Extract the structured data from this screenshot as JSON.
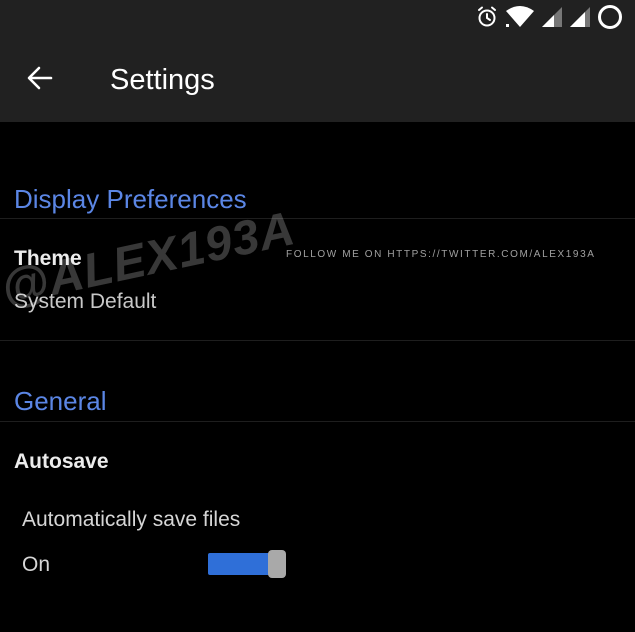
{
  "status_bar": {
    "icons": [
      "alarm-icon",
      "wifi-icon",
      "signal-icon",
      "signal-icon-2",
      "battery-ring-icon"
    ]
  },
  "app_bar": {
    "title": "Settings",
    "back_icon": "arrow-left-icon"
  },
  "sections": {
    "display": {
      "header": "Display Preferences",
      "theme": {
        "title": "Theme",
        "summary": "System Default"
      }
    },
    "general": {
      "header": "General",
      "autosave": {
        "title": "Autosave",
        "description": "Automatically save files",
        "state_label": "On",
        "enabled": true
      }
    }
  },
  "watermark": {
    "follow": "FOLLOW ME ON HTTPS://TWITTER.COM/ALEX193A",
    "handle": "@ALEX193A"
  },
  "colors": {
    "bar_background": "#212121",
    "accent": "#5b86e5",
    "toggle_track": "#2f6fd8",
    "toggle_thumb": "#a9a9a9",
    "background": "#000000"
  }
}
